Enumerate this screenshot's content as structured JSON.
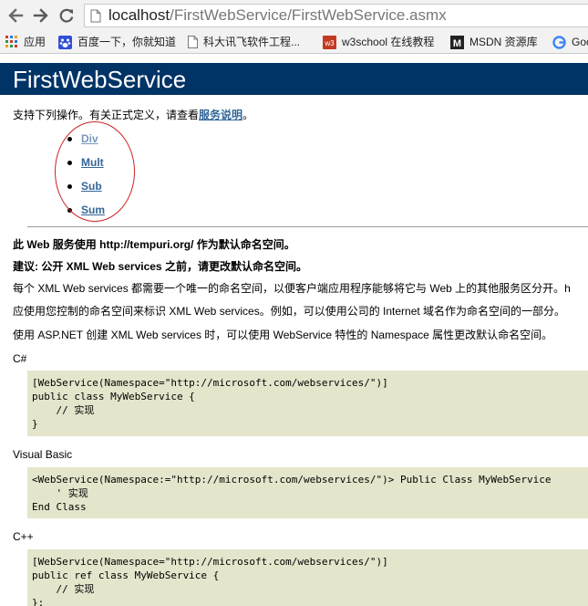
{
  "browser": {
    "url_host": "localhost",
    "url_path": "/FirstWebService/FirstWebService.asmx",
    "bookmarks": [
      {
        "icon": "apps-grid-icon",
        "label": "应用"
      },
      {
        "icon": "baidu-paw-icon",
        "label": "百度一下，你就知道"
      },
      {
        "icon": "page-icon",
        "label": "科大讯飞软件工程..."
      },
      {
        "icon": "w3school-icon",
        "label": "w3school 在线教程"
      },
      {
        "icon": "msdn-icon",
        "label": "MSDN 资源库"
      },
      {
        "icon": "google-icon",
        "label": "Goo"
      }
    ],
    "colors": {
      "chrome": "#f2f2f2",
      "header": "#003366",
      "link": "#336699",
      "code_bg": "#e5e5cc"
    }
  },
  "page": {
    "heading": "FirstWebService",
    "intro_text": "支持下列操作。有关正式定义，请查看",
    "intro_link": "服务说明",
    "intro_end": "。",
    "operations": [
      "Div",
      "Mult",
      "Sub",
      "Sum"
    ],
    "namespace_notice": "此 Web 服务使用 http://tempuri.org/ 作为默认命名空间。",
    "recommendation": "建议: 公开 XML Web services 之前，请更改默认命名空间。",
    "para1": "每个 XML Web services 都需要一个唯一的命名空间，以便客户端应用程序能够将它与 Web 上的其他服务区分开。h",
    "para2": "应使用您控制的命名空间来标识 XML Web services。例如，可以使用公司的 Internet 域名作为命名空间的一部分。",
    "para3": "使用 ASP.NET 创建 XML Web services 时，可以使用 WebService 特性的 Namespace 属性更改默认命名空间。",
    "csharp_label": "C#",
    "csharp_code": "[WebService(Namespace=\"http://microsoft.com/webservices/\")]\npublic class MyWebService {\n    // 实现\n}",
    "vb_label": "Visual Basic",
    "vb_code": "<WebService(Namespace:=\"http://microsoft.com/webservices/\")> Public Class MyWebService\n    ' 实现\nEnd Class",
    "cpp_label": "C++",
    "cpp_code": "[WebService(Namespace=\"http://microsoft.com/webservices/\")]\npublic ref class MyWebService {\n    // 实现\n};"
  }
}
